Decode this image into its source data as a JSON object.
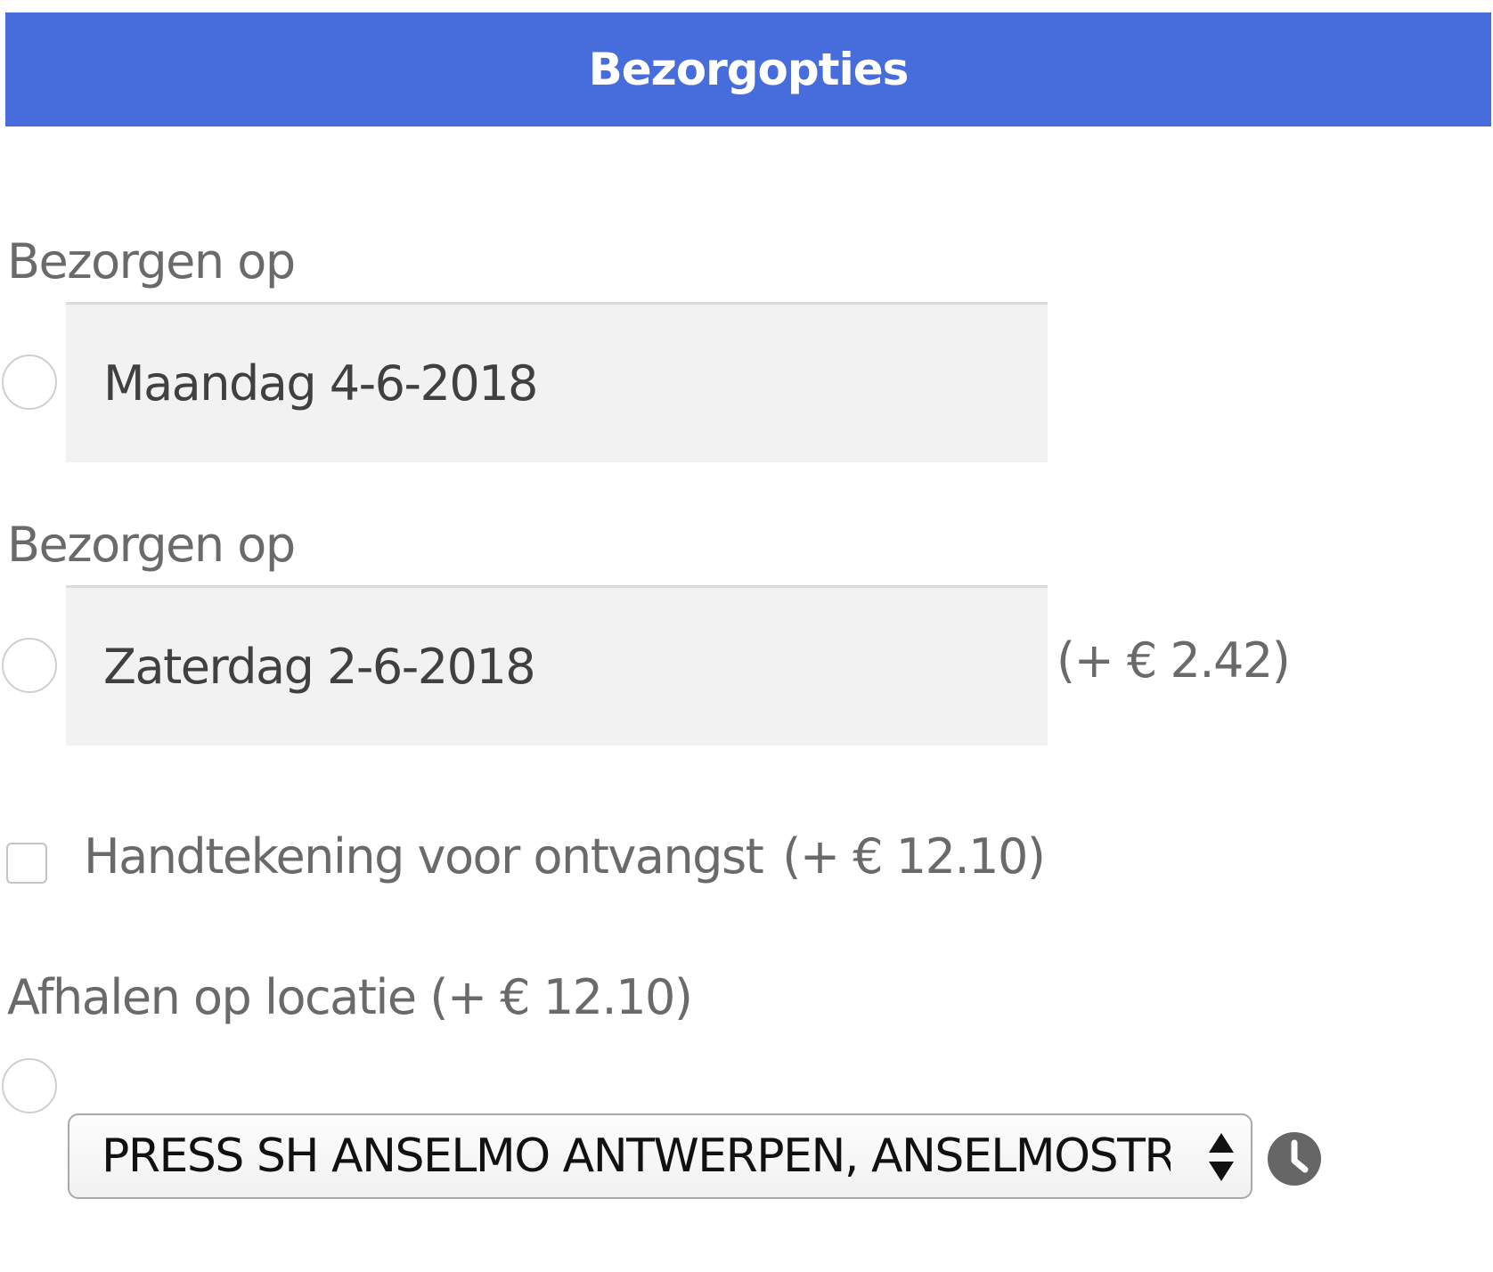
{
  "header": {
    "title": "Bezorgopties"
  },
  "delivery_options": [
    {
      "label": "Bezorgen op",
      "date": "Maandag 4-6-2018",
      "surcharge": "",
      "selected": false
    },
    {
      "label": "Bezorgen op",
      "date": "Zaterdag 2-6-2018",
      "surcharge": "(+ € 2.42)",
      "selected": false
    }
  ],
  "signature": {
    "label": "Handtekening voor ontvangst",
    "price": "(+ € 12.10)",
    "checked": false
  },
  "pickup": {
    "label": "Afhalen op locatie (+ € 12.10)",
    "selected_location": "PRESS SH ANSELMO ANTWERPEN, ANSELMOSTRAAT",
    "selected": false
  },
  "icons": {
    "select_arrows": "up-down-arrows-icon",
    "opening_hours": "clock-icon"
  },
  "colors": {
    "header_bg": "#476cdb",
    "header_text": "#ffffff",
    "label_text": "#6a6a6a",
    "box_bg": "#f2f2f2"
  }
}
